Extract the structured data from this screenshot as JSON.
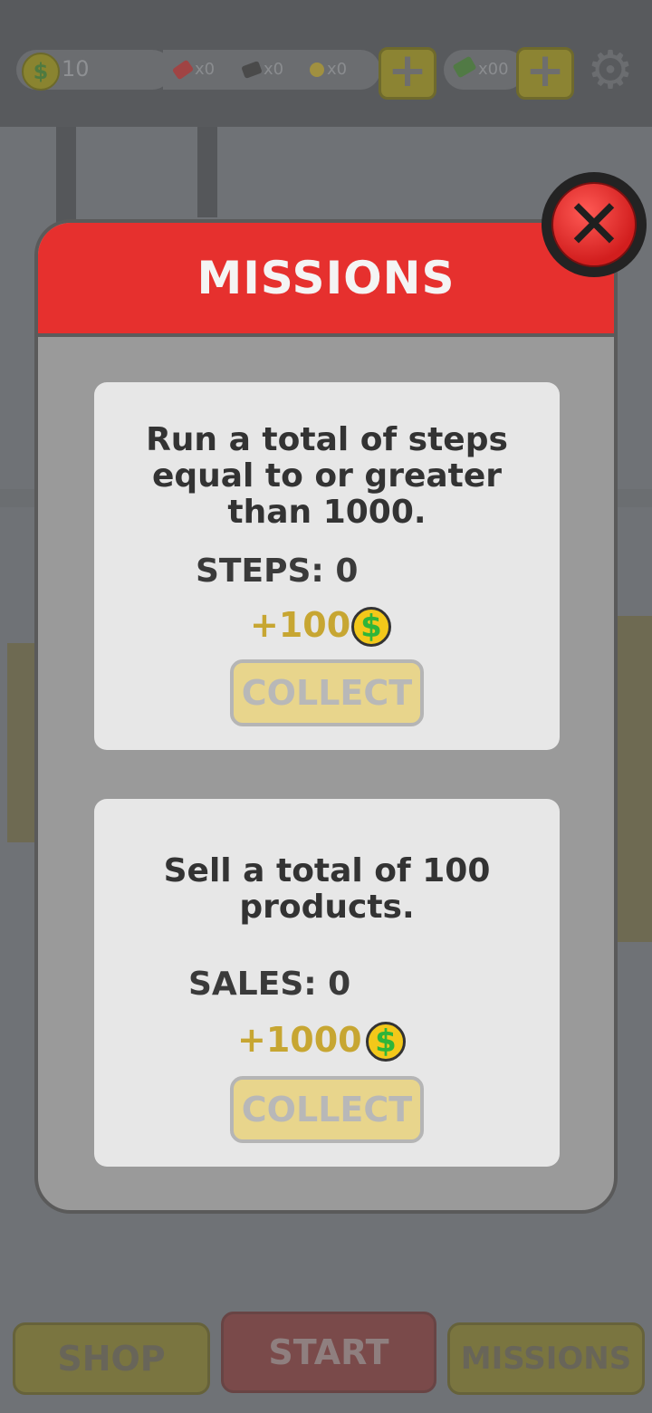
{
  "hud": {
    "coins": "10",
    "items": [
      {
        "icon": "fire-extinguisher-icon",
        "count": "x0",
        "color": "#a04444"
      },
      {
        "icon": "broom-icon",
        "count": "x0",
        "color": "#4a4a4a"
      },
      {
        "icon": "magnet-icon",
        "count": "x0",
        "color": "#a09040"
      }
    ],
    "cash": "x00",
    "plus_label": "+",
    "settings_icon": "gear-icon"
  },
  "modal": {
    "title": "MISSIONS",
    "close_icon": "close-icon",
    "missions": [
      {
        "description": "Run a total of steps equal to or greater than 1000.",
        "desc_lines": [
          "Run a total of steps",
          "equal to or greater",
          "than 1000."
        ],
        "progress": "STEPS: 0",
        "reward": "+100",
        "reward_icon": "dollar-coin-icon",
        "button": "COLLECT"
      },
      {
        "description": "Sell a total of 100 products.",
        "desc_lines": [
          "Sell a total of 100",
          "products."
        ],
        "progress": "SALES: 0",
        "reward": "+1000",
        "reward_icon": "dollar-coin-icon",
        "button": "COLLECT"
      }
    ]
  },
  "nav": {
    "shop": "SHOP",
    "start": "START",
    "missions": "MISSIONS"
  },
  "colors": {
    "header_red": "#e6302e",
    "reward_gold": "#c7a632",
    "card_bg": "#e7e7e7"
  }
}
